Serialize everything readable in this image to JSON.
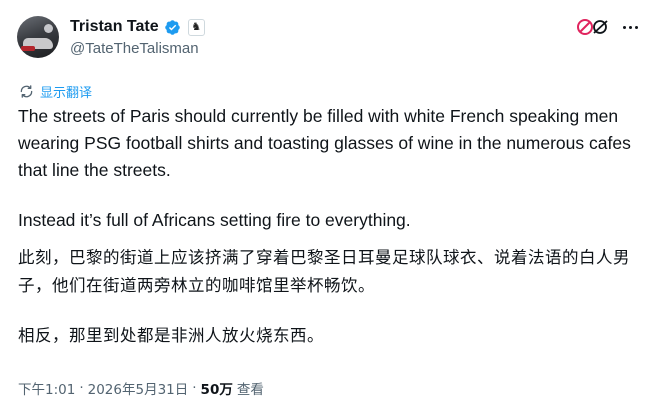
{
  "author": {
    "display_name": "Tristan Tate",
    "handle": "@TateTheTalisman",
    "verified": true,
    "affiliate_badge_icon": "chess-knight-icon"
  },
  "actions": {
    "grok_icon": "grok-icon",
    "more_icon": "more-horizontal-icon"
  },
  "translate": {
    "icon": "translate-icon",
    "label": "显示翻译"
  },
  "tweet": {
    "paragraph_1": "The streets of Paris should currently be filled with white French speaking men wearing PSG football shirts and toasting glasses of wine in the numerous cafes that line the streets.",
    "paragraph_2": "Instead it’s full of Africans setting fire to everything.",
    "translation_1": "此刻，巴黎的街道上应该挤满了穿着巴黎圣日耳曼足球队球衣、说着法语的白人男子，他们在街道两旁林立的咖啡馆里举杯畅饮。",
    "translation_2": "相反，那里到处都是非洲人放火烧东西。"
  },
  "meta": {
    "time": "下午1:01",
    "separator": "·",
    "date": "2026年5月31日",
    "views_count": "50万",
    "views_label": "查看"
  },
  "colors": {
    "accent": "#1d9bf0",
    "text_primary": "#0f1419",
    "text_secondary": "#536471",
    "grok_red": "#e0245e"
  }
}
